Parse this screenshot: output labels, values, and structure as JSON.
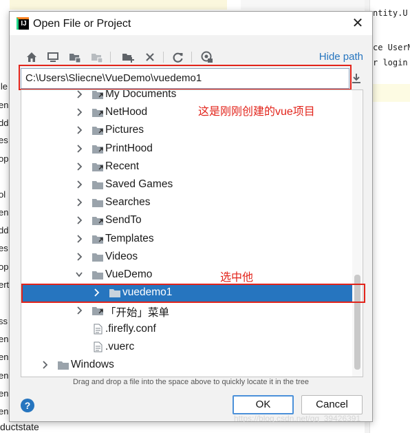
{
  "background": {
    "left_fragments": [
      "lle",
      "en",
      "dd",
      "es",
      "op",
      "ol",
      "en",
      "dd",
      "es",
      "op",
      "ert",
      "ss",
      "en",
      "en",
      "en",
      "en",
      "en"
    ],
    "bottom_text": "ductstate",
    "right_code": [
      "ntity.U",
      "ce UserM",
      "r login"
    ]
  },
  "dialog": {
    "title": "Open File or Project",
    "close_glyph": "✕",
    "hide_path_label": "Hide path",
    "path_value": "C:\\Users\\Sliecne\\VueDemo\\vuedemo1",
    "tree": [
      {
        "label": "My Documents",
        "type": "link-folder",
        "expand": "collapsed",
        "level": 1,
        "selected": false
      },
      {
        "label": "NetHood",
        "type": "link-folder",
        "expand": "collapsed",
        "level": 1,
        "selected": false
      },
      {
        "label": "Pictures",
        "type": "link-folder",
        "expand": "collapsed",
        "level": 1,
        "selected": false
      },
      {
        "label": "PrintHood",
        "type": "link-folder",
        "expand": "collapsed",
        "level": 1,
        "selected": false
      },
      {
        "label": "Recent",
        "type": "link-folder",
        "expand": "collapsed",
        "level": 1,
        "selected": false
      },
      {
        "label": "Saved Games",
        "type": "folder",
        "expand": "collapsed",
        "level": 1,
        "selected": false
      },
      {
        "label": "Searches",
        "type": "folder",
        "expand": "collapsed",
        "level": 1,
        "selected": false
      },
      {
        "label": "SendTo",
        "type": "link-folder",
        "expand": "collapsed",
        "level": 1,
        "selected": false
      },
      {
        "label": "Templates",
        "type": "link-folder",
        "expand": "collapsed",
        "level": 1,
        "selected": false
      },
      {
        "label": "Videos",
        "type": "folder",
        "expand": "collapsed",
        "level": 1,
        "selected": false
      },
      {
        "label": "VueDemo",
        "type": "folder",
        "expand": "expanded",
        "level": 1,
        "selected": false
      },
      {
        "label": "vuedemo1",
        "type": "folder",
        "expand": "collapsed",
        "level": 2,
        "selected": true
      },
      {
        "label": "「开始」菜单",
        "type": "link-folder",
        "expand": "collapsed",
        "level": 1,
        "selected": false
      },
      {
        "label": ".firefly.conf",
        "type": "file",
        "expand": "none",
        "level": 1,
        "selected": false
      },
      {
        "label": ".vuerc",
        "type": "file",
        "expand": "none",
        "level": 1,
        "selected": false
      },
      {
        "label": "Windows",
        "type": "folder",
        "expand": "collapsed",
        "level": 0,
        "selected": false
      }
    ],
    "annotation_project": "这是刚刚创建的vue项目",
    "annotation_select": "选中他",
    "hint": "Drag and drop a file into the space above to quickly locate it in the tree",
    "help_glyph": "?",
    "ok_label": "OK",
    "cancel_label": "Cancel"
  },
  "watermark": "https://blog.csdn.net/qq_39426391",
  "colors": {
    "accent": "#2675bf",
    "annotation": "#e2231a",
    "folder": "#9aa3ab"
  }
}
